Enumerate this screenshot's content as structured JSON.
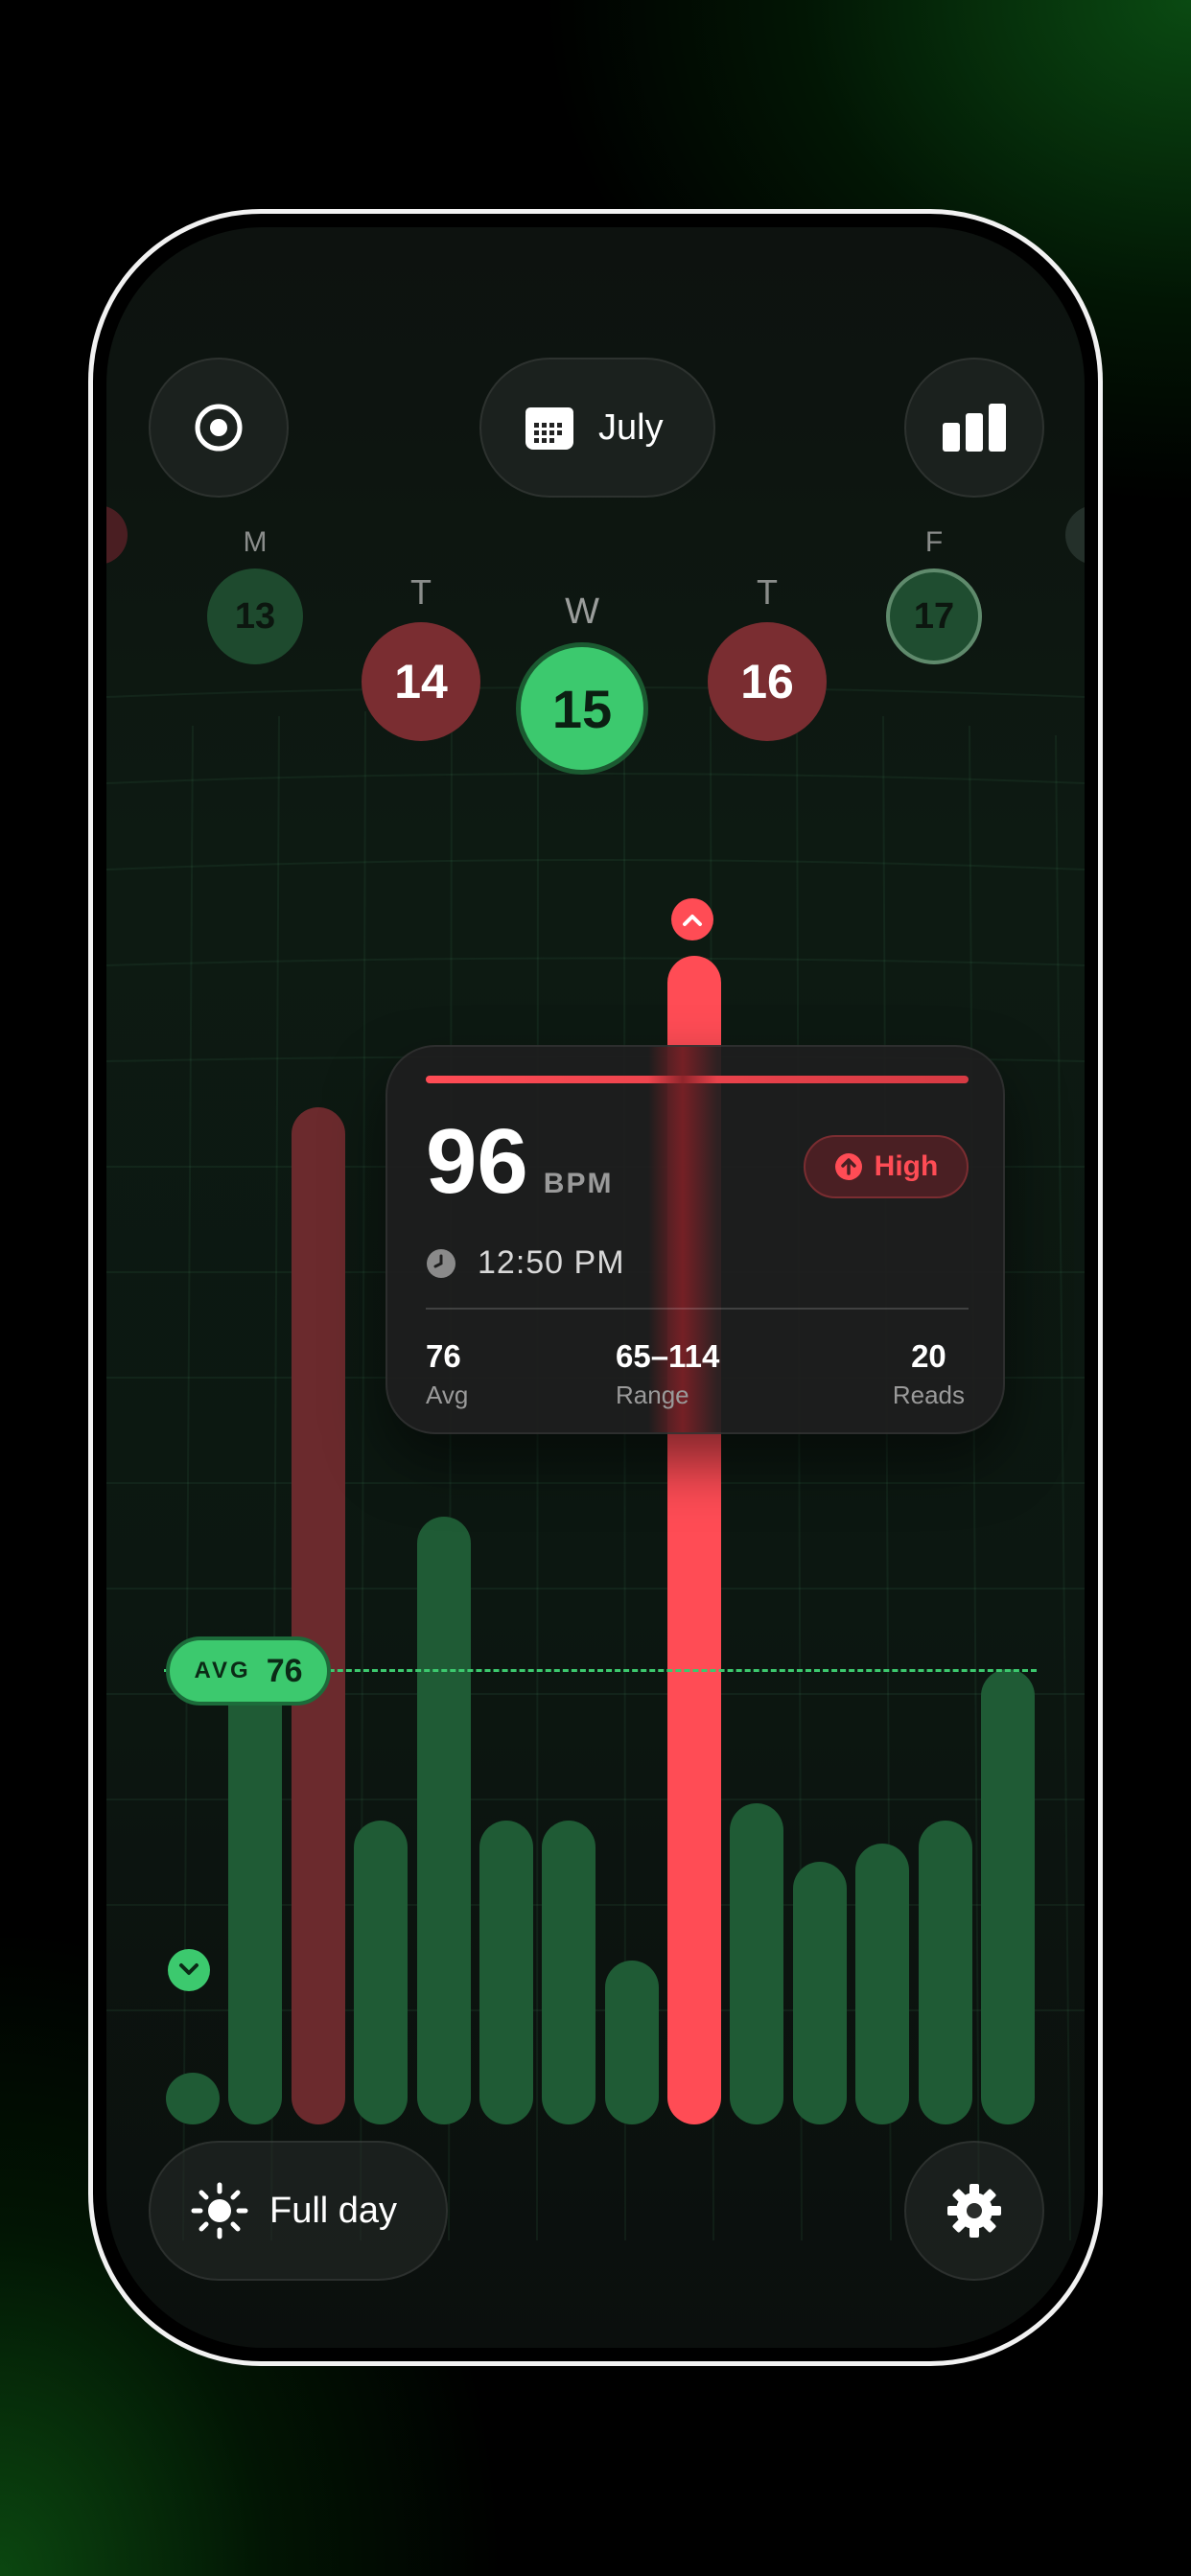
{
  "header": {
    "month_label": "July"
  },
  "colors": {
    "green": "#3cc96e",
    "green_dim": "#1f5b35",
    "red": "#ff4c55",
    "red_dim": "#6b2a2d"
  },
  "days": [
    {
      "letter": "M",
      "date": "13"
    },
    {
      "letter": "T",
      "date": "14"
    },
    {
      "letter": "W",
      "date": "15"
    },
    {
      "letter": "T",
      "date": "16"
    },
    {
      "letter": "F",
      "date": "17"
    }
  ],
  "detail": {
    "bpm": "96",
    "unit": "BPM",
    "badge": "High",
    "time": "12:50 PM",
    "avg_value": "76",
    "avg_label": "Avg",
    "range_value": "65–114",
    "range_label": "Range",
    "reads_value": "20",
    "reads_label": "Reads"
  },
  "avg_marker": {
    "label": "AVG",
    "value": "76"
  },
  "chart_data": {
    "type": "bar",
    "bar_relative_heights": [
      0.05,
      0.4,
      0.87,
      0.26,
      0.52,
      0.26,
      0.26,
      0.14,
      1.0,
      0.275,
      0.225,
      0.24,
      0.26,
      0.39
    ],
    "bar_status": [
      "low",
      "normal",
      "high",
      "normal",
      "normal",
      "normal",
      "normal",
      "normal",
      "high-selected",
      "normal",
      "normal",
      "normal",
      "normal",
      "normal"
    ],
    "average_line": 76
  },
  "footer": {
    "range_label": "Full day"
  }
}
